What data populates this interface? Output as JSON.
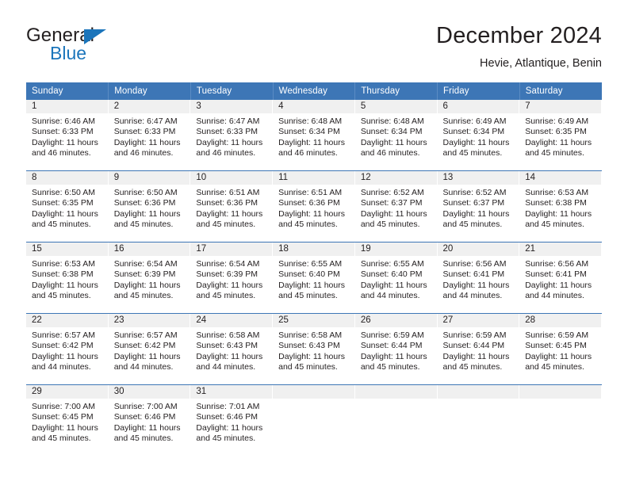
{
  "brand": {
    "name_top": "General",
    "name_bottom": "Blue",
    "accent_color": "#1b75bb"
  },
  "header": {
    "title": "December 2024",
    "subtitle": "Hevie, Atlantique, Benin"
  },
  "calendar": {
    "header_color": "#3d76b6",
    "daynum_band_color": "#f0f0f0",
    "weekdays": [
      "Sunday",
      "Monday",
      "Tuesday",
      "Wednesday",
      "Thursday",
      "Friday",
      "Saturday"
    ],
    "weeks": [
      [
        {
          "day": "1",
          "sunrise": "Sunrise: 6:46 AM",
          "sunset": "Sunset: 6:33 PM",
          "daylight1": "Daylight: 11 hours",
          "daylight2": "and 46 minutes."
        },
        {
          "day": "2",
          "sunrise": "Sunrise: 6:47 AM",
          "sunset": "Sunset: 6:33 PM",
          "daylight1": "Daylight: 11 hours",
          "daylight2": "and 46 minutes."
        },
        {
          "day": "3",
          "sunrise": "Sunrise: 6:47 AM",
          "sunset": "Sunset: 6:33 PM",
          "daylight1": "Daylight: 11 hours",
          "daylight2": "and 46 minutes."
        },
        {
          "day": "4",
          "sunrise": "Sunrise: 6:48 AM",
          "sunset": "Sunset: 6:34 PM",
          "daylight1": "Daylight: 11 hours",
          "daylight2": "and 46 minutes."
        },
        {
          "day": "5",
          "sunrise": "Sunrise: 6:48 AM",
          "sunset": "Sunset: 6:34 PM",
          "daylight1": "Daylight: 11 hours",
          "daylight2": "and 46 minutes."
        },
        {
          "day": "6",
          "sunrise": "Sunrise: 6:49 AM",
          "sunset": "Sunset: 6:34 PM",
          "daylight1": "Daylight: 11 hours",
          "daylight2": "and 45 minutes."
        },
        {
          "day": "7",
          "sunrise": "Sunrise: 6:49 AM",
          "sunset": "Sunset: 6:35 PM",
          "daylight1": "Daylight: 11 hours",
          "daylight2": "and 45 minutes."
        }
      ],
      [
        {
          "day": "8",
          "sunrise": "Sunrise: 6:50 AM",
          "sunset": "Sunset: 6:35 PM",
          "daylight1": "Daylight: 11 hours",
          "daylight2": "and 45 minutes."
        },
        {
          "day": "9",
          "sunrise": "Sunrise: 6:50 AM",
          "sunset": "Sunset: 6:36 PM",
          "daylight1": "Daylight: 11 hours",
          "daylight2": "and 45 minutes."
        },
        {
          "day": "10",
          "sunrise": "Sunrise: 6:51 AM",
          "sunset": "Sunset: 6:36 PM",
          "daylight1": "Daylight: 11 hours",
          "daylight2": "and 45 minutes."
        },
        {
          "day": "11",
          "sunrise": "Sunrise: 6:51 AM",
          "sunset": "Sunset: 6:36 PM",
          "daylight1": "Daylight: 11 hours",
          "daylight2": "and 45 minutes."
        },
        {
          "day": "12",
          "sunrise": "Sunrise: 6:52 AM",
          "sunset": "Sunset: 6:37 PM",
          "daylight1": "Daylight: 11 hours",
          "daylight2": "and 45 minutes."
        },
        {
          "day": "13",
          "sunrise": "Sunrise: 6:52 AM",
          "sunset": "Sunset: 6:37 PM",
          "daylight1": "Daylight: 11 hours",
          "daylight2": "and 45 minutes."
        },
        {
          "day": "14",
          "sunrise": "Sunrise: 6:53 AM",
          "sunset": "Sunset: 6:38 PM",
          "daylight1": "Daylight: 11 hours",
          "daylight2": "and 45 minutes."
        }
      ],
      [
        {
          "day": "15",
          "sunrise": "Sunrise: 6:53 AM",
          "sunset": "Sunset: 6:38 PM",
          "daylight1": "Daylight: 11 hours",
          "daylight2": "and 45 minutes."
        },
        {
          "day": "16",
          "sunrise": "Sunrise: 6:54 AM",
          "sunset": "Sunset: 6:39 PM",
          "daylight1": "Daylight: 11 hours",
          "daylight2": "and 45 minutes."
        },
        {
          "day": "17",
          "sunrise": "Sunrise: 6:54 AM",
          "sunset": "Sunset: 6:39 PM",
          "daylight1": "Daylight: 11 hours",
          "daylight2": "and 45 minutes."
        },
        {
          "day": "18",
          "sunrise": "Sunrise: 6:55 AM",
          "sunset": "Sunset: 6:40 PM",
          "daylight1": "Daylight: 11 hours",
          "daylight2": "and 45 minutes."
        },
        {
          "day": "19",
          "sunrise": "Sunrise: 6:55 AM",
          "sunset": "Sunset: 6:40 PM",
          "daylight1": "Daylight: 11 hours",
          "daylight2": "and 44 minutes."
        },
        {
          "day": "20",
          "sunrise": "Sunrise: 6:56 AM",
          "sunset": "Sunset: 6:41 PM",
          "daylight1": "Daylight: 11 hours",
          "daylight2": "and 44 minutes."
        },
        {
          "day": "21",
          "sunrise": "Sunrise: 6:56 AM",
          "sunset": "Sunset: 6:41 PM",
          "daylight1": "Daylight: 11 hours",
          "daylight2": "and 44 minutes."
        }
      ],
      [
        {
          "day": "22",
          "sunrise": "Sunrise: 6:57 AM",
          "sunset": "Sunset: 6:42 PM",
          "daylight1": "Daylight: 11 hours",
          "daylight2": "and 44 minutes."
        },
        {
          "day": "23",
          "sunrise": "Sunrise: 6:57 AM",
          "sunset": "Sunset: 6:42 PM",
          "daylight1": "Daylight: 11 hours",
          "daylight2": "and 44 minutes."
        },
        {
          "day": "24",
          "sunrise": "Sunrise: 6:58 AM",
          "sunset": "Sunset: 6:43 PM",
          "daylight1": "Daylight: 11 hours",
          "daylight2": "and 44 minutes."
        },
        {
          "day": "25",
          "sunrise": "Sunrise: 6:58 AM",
          "sunset": "Sunset: 6:43 PM",
          "daylight1": "Daylight: 11 hours",
          "daylight2": "and 45 minutes."
        },
        {
          "day": "26",
          "sunrise": "Sunrise: 6:59 AM",
          "sunset": "Sunset: 6:44 PM",
          "daylight1": "Daylight: 11 hours",
          "daylight2": "and 45 minutes."
        },
        {
          "day": "27",
          "sunrise": "Sunrise: 6:59 AM",
          "sunset": "Sunset: 6:44 PM",
          "daylight1": "Daylight: 11 hours",
          "daylight2": "and 45 minutes."
        },
        {
          "day": "28",
          "sunrise": "Sunrise: 6:59 AM",
          "sunset": "Sunset: 6:45 PM",
          "daylight1": "Daylight: 11 hours",
          "daylight2": "and 45 minutes."
        }
      ],
      [
        {
          "day": "29",
          "sunrise": "Sunrise: 7:00 AM",
          "sunset": "Sunset: 6:45 PM",
          "daylight1": "Daylight: 11 hours",
          "daylight2": "and 45 minutes."
        },
        {
          "day": "30",
          "sunrise": "Sunrise: 7:00 AM",
          "sunset": "Sunset: 6:46 PM",
          "daylight1": "Daylight: 11 hours",
          "daylight2": "and 45 minutes."
        },
        {
          "day": "31",
          "sunrise": "Sunrise: 7:01 AM",
          "sunset": "Sunset: 6:46 PM",
          "daylight1": "Daylight: 11 hours",
          "daylight2": "and 45 minutes."
        },
        {
          "day": "",
          "sunrise": "",
          "sunset": "",
          "daylight1": "",
          "daylight2": ""
        },
        {
          "day": "",
          "sunrise": "",
          "sunset": "",
          "daylight1": "",
          "daylight2": ""
        },
        {
          "day": "",
          "sunrise": "",
          "sunset": "",
          "daylight1": "",
          "daylight2": ""
        },
        {
          "day": "",
          "sunrise": "",
          "sunset": "",
          "daylight1": "",
          "daylight2": ""
        }
      ]
    ]
  }
}
